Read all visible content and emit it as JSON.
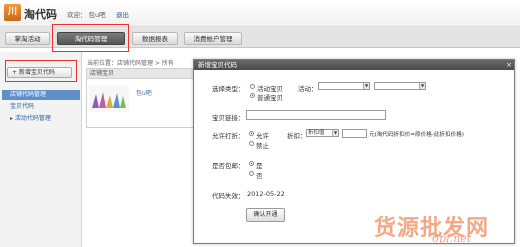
{
  "header": {
    "logo_char": "川",
    "logo_text": "淘代码",
    "welcome": "欢迎：",
    "username": "包u吧",
    "logout": "退出"
  },
  "nav": {
    "tabs": [
      "掌淘活动",
      "淘代码管理",
      "数据报表",
      "消费帐户管理"
    ],
    "active_index": 1
  },
  "sidebar": {
    "add_button": "+ 新增宝贝代码",
    "items": [
      "店铺代码管理",
      "宝贝代码",
      "▸ 活动代码管理"
    ]
  },
  "main": {
    "breadcrumb": "当前位置：店铺代码管理 > 所有",
    "panel_header": "店铺宝贝",
    "product_name": "包u吧"
  },
  "dialog": {
    "title": "新增宝贝代码",
    "close": "×",
    "choose_type_label": "选择类型：",
    "type_options": [
      "活动宝贝",
      "普通宝贝"
    ],
    "type_selected_index": 1,
    "activity_label": "活动：",
    "link_label": "宝贝链接：",
    "discount_allow_label": "允许打折：",
    "discount_options": [
      "允许",
      "禁止"
    ],
    "discount_selected_index": 0,
    "discount_label": "折扣：",
    "discount_select_value": "折扣值",
    "discount_note": "元(淘代码折扣价=原价格-此折扣价格)",
    "free_ship_label": "是否包邮：",
    "free_ship_options": [
      "是",
      "否"
    ],
    "free_ship_selected_index": 0,
    "expiry_label": "代码失效：",
    "expiry_value": "2012-05-22",
    "confirm_button": "确认开通"
  },
  "watermark": {
    "line1": "货源批发网",
    "line2": "6pf.net"
  },
  "colors": {
    "highlight_box": "#e8342e",
    "active_sidebar": "#5f8fc8",
    "dialog_titlebar": "#555555",
    "watermark": "#f2a07a"
  }
}
